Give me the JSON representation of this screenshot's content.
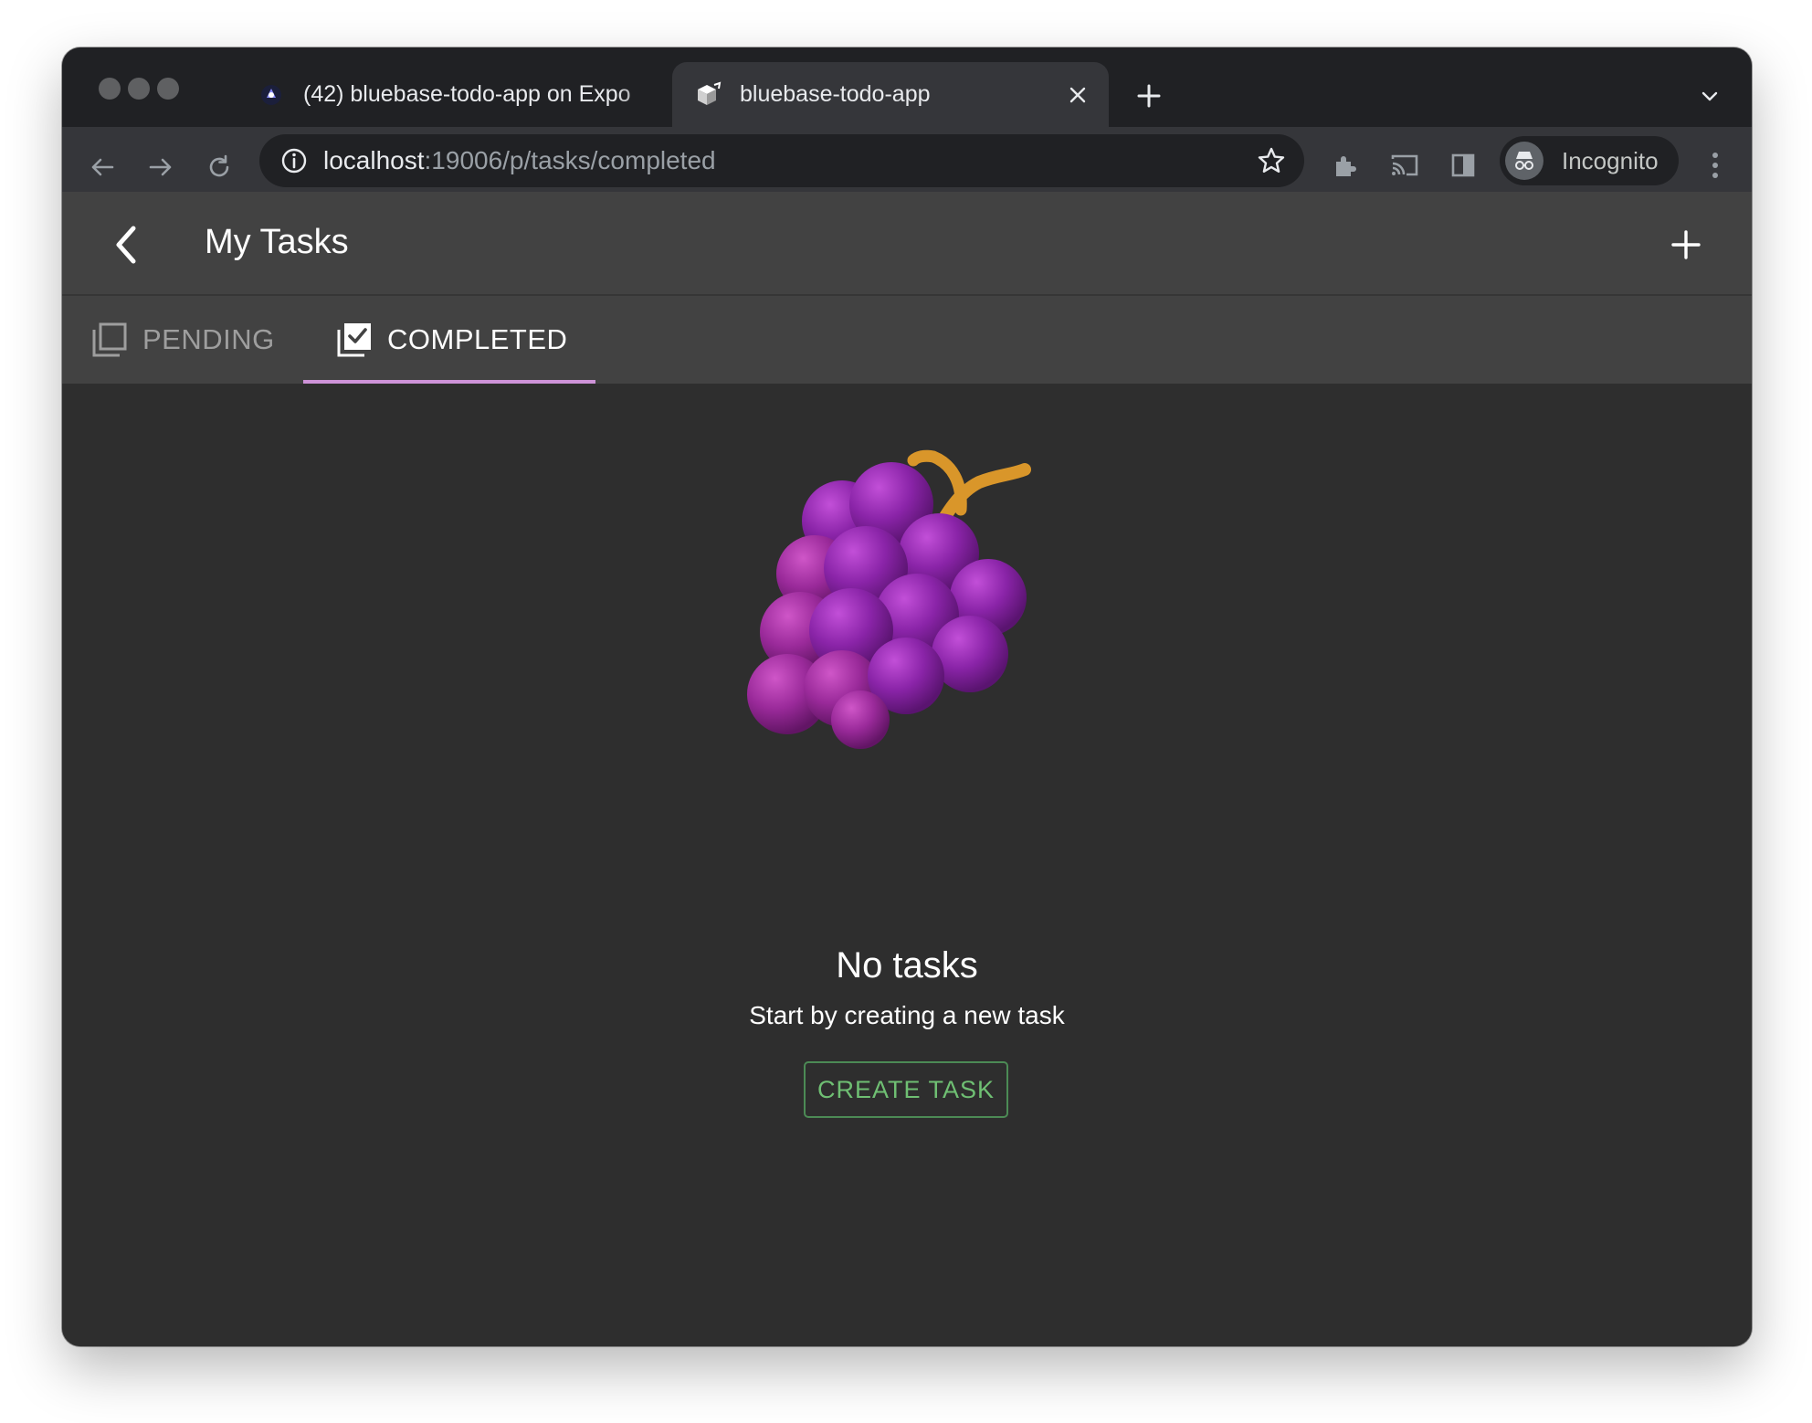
{
  "browser": {
    "tabs": [
      {
        "title": "(42) bluebase-todo-app on Expo",
        "favicon": "expo-icon",
        "active": false
      },
      {
        "title": "bluebase-todo-app",
        "favicon": "bluebase-icon",
        "active": true
      }
    ],
    "url_host": "localhost",
    "url_rest": ":19006/p/tasks/completed",
    "profile_label": "Incognito"
  },
  "appbar": {
    "title": "My Tasks"
  },
  "tabs": {
    "pending_label": "PENDING",
    "completed_label": "COMPLETED",
    "active": "COMPLETED"
  },
  "empty_state": {
    "illustration": "grapes-icon",
    "title": "No tasks",
    "subtitle": "Start by creating a new task",
    "button_label": "CREATE TASK"
  },
  "colors": {
    "tab_indicator": "#ce93d8",
    "button_text": "#6fbf73",
    "button_border": "#4c8a55",
    "appbar_bg": "#424242",
    "content_bg": "#2e2e2e"
  }
}
